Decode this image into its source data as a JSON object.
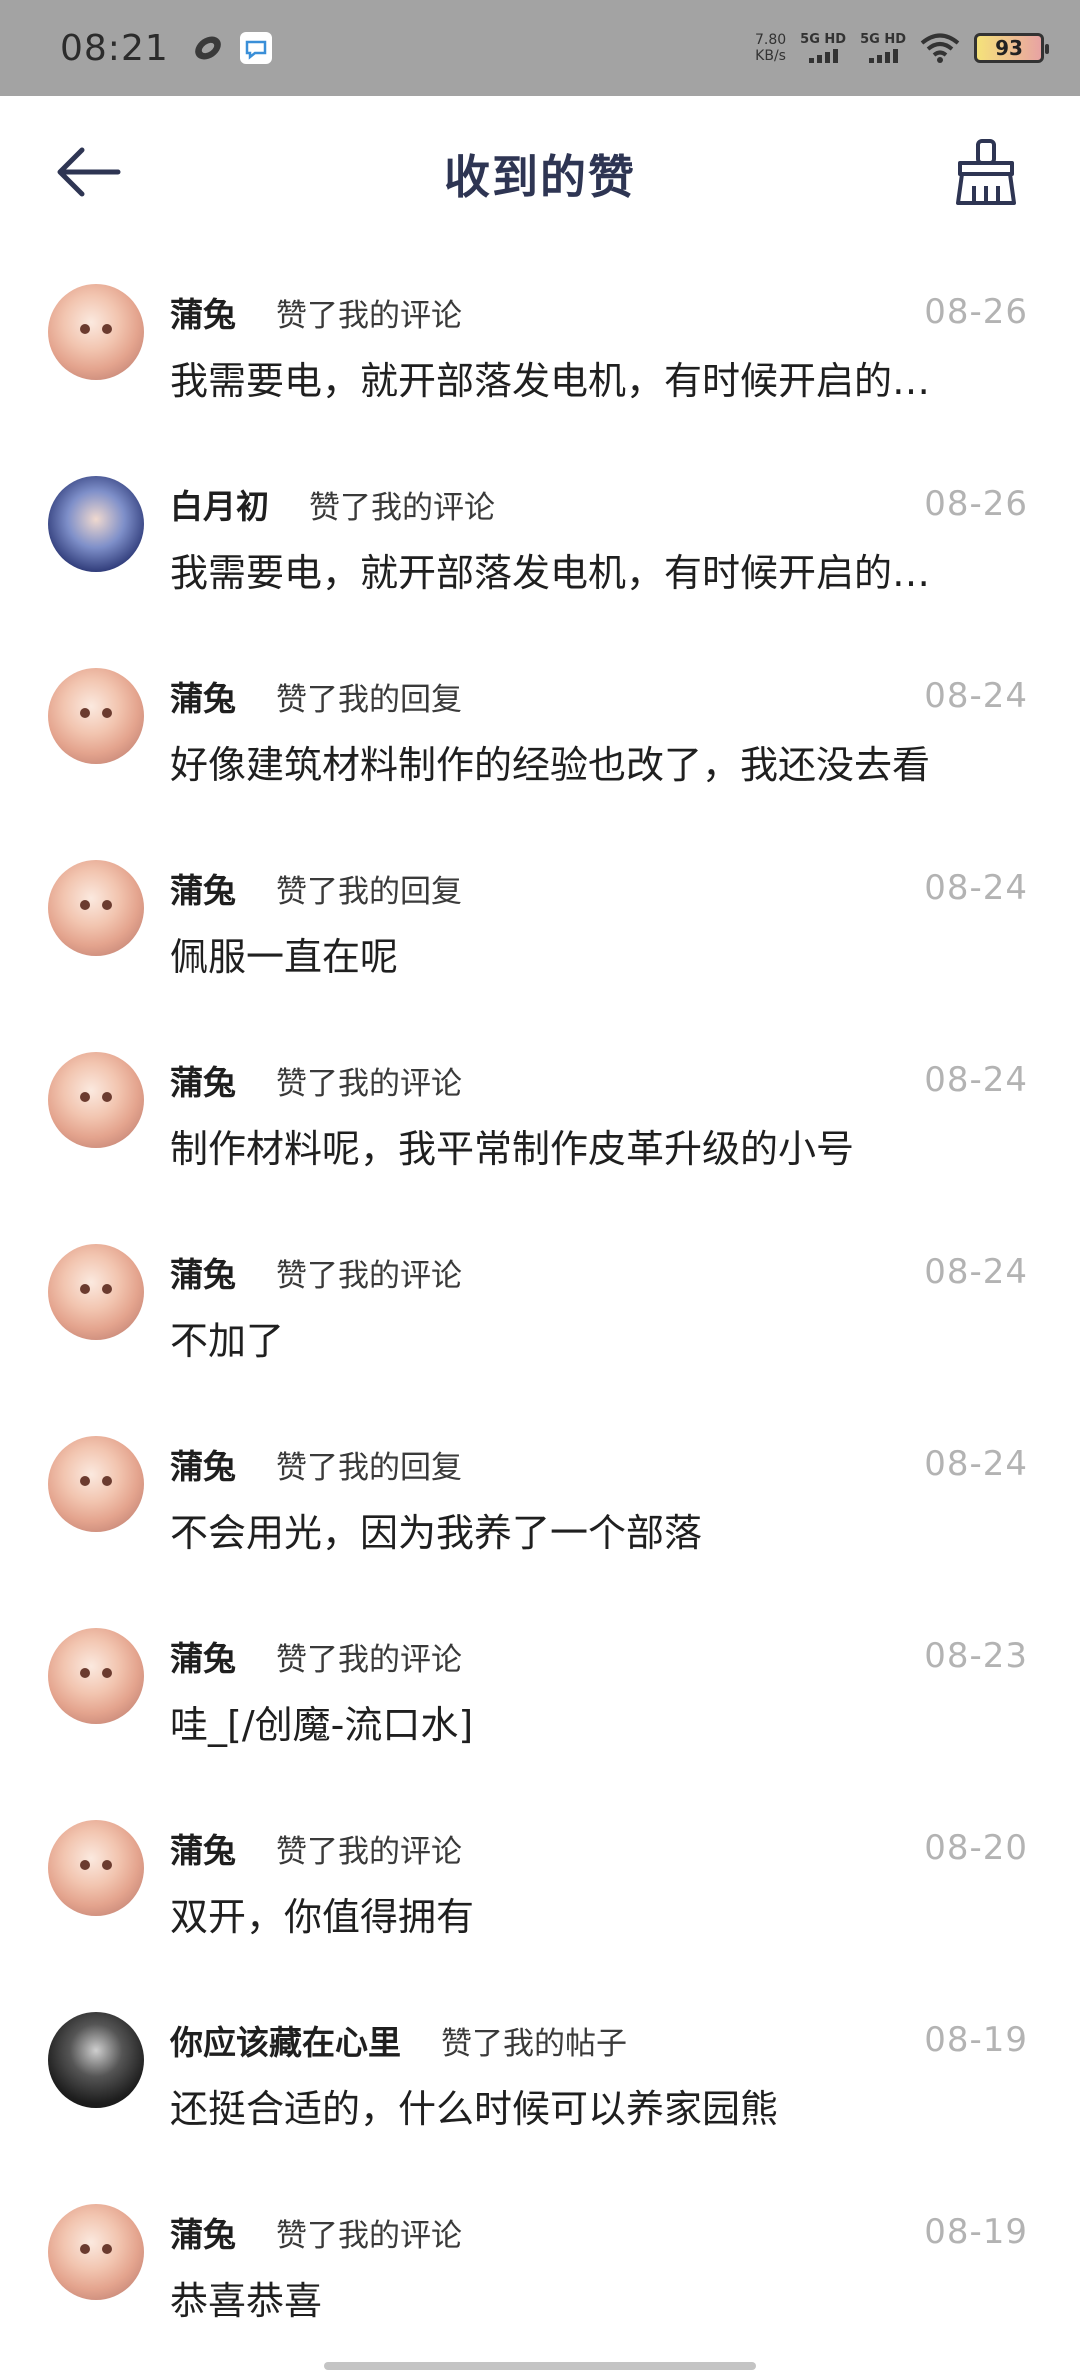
{
  "status_bar": {
    "time": "08:21",
    "netspeed_value": "7.80",
    "netspeed_unit": "KB/s",
    "signal1_label": "5G HD",
    "signal2_label": "5G HD",
    "battery": "93"
  },
  "header": {
    "title": "收到的赞"
  },
  "items": [
    {
      "user": "蒲兔",
      "action": "赞了我的评论",
      "date": "08-26",
      "content": "我需要电，就开部落发电机，有时候开启的…",
      "avatar": "rabbit"
    },
    {
      "user": "白月初",
      "action": "赞了我的评论",
      "date": "08-26",
      "content": "我需要电，就开部落发电机，有时候开启的…",
      "avatar": "anime"
    },
    {
      "user": "蒲兔",
      "action": "赞了我的回复",
      "date": "08-24",
      "content": "好像建筑材料制作的经验也改了，我还没去看",
      "avatar": "rabbit"
    },
    {
      "user": "蒲兔",
      "action": "赞了我的回复",
      "date": "08-24",
      "content": "佩服一直在呢",
      "avatar": "rabbit"
    },
    {
      "user": "蒲兔",
      "action": "赞了我的评论",
      "date": "08-24",
      "content": "制作材料呢，我平常制作皮革升级的小号",
      "avatar": "rabbit"
    },
    {
      "user": "蒲兔",
      "action": "赞了我的评论",
      "date": "08-24",
      "content": "不加了",
      "avatar": "rabbit"
    },
    {
      "user": "蒲兔",
      "action": "赞了我的回复",
      "date": "08-24",
      "content": "不会用光，因为我养了一个部落",
      "avatar": "rabbit"
    },
    {
      "user": "蒲兔",
      "action": "赞了我的评论",
      "date": "08-23",
      "content": "哇_[/创魔-流口水]",
      "avatar": "rabbit"
    },
    {
      "user": "蒲兔",
      "action": "赞了我的评论",
      "date": "08-20",
      "content": "双开，你值得拥有",
      "avatar": "rabbit"
    },
    {
      "user": "你应该藏在心里",
      "action": "赞了我的帖子",
      "date": "08-19",
      "content": "还挺合适的，什么时候可以养家园熊",
      "avatar": "dark"
    },
    {
      "user": "蒲兔",
      "action": "赞了我的评论",
      "date": "08-19",
      "content": "恭喜恭喜",
      "avatar": "rabbit"
    }
  ]
}
